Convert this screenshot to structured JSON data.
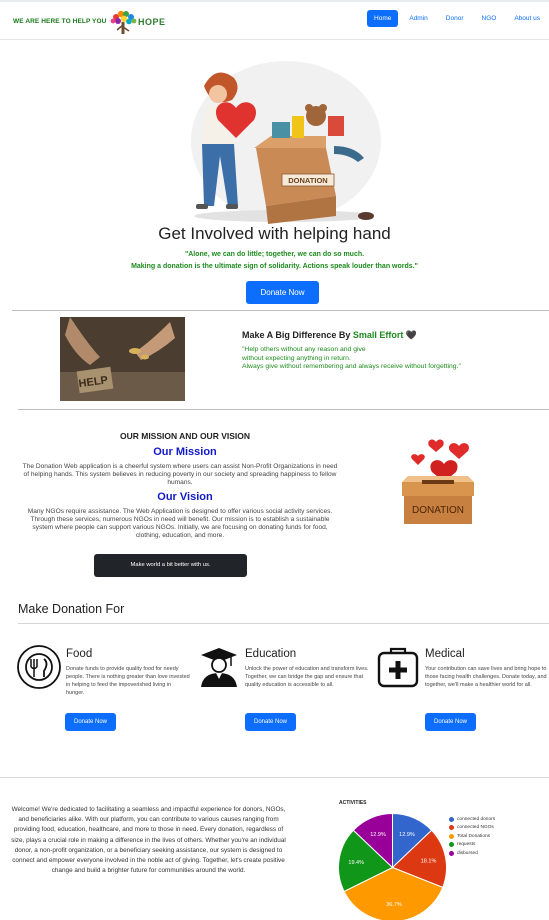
{
  "navbar": {
    "tagline": "WE ARE HERE TO HELP YOU",
    "brand": "HOPE",
    "links": [
      "Home",
      "Admin",
      "Donor",
      "NGO",
      "About us"
    ]
  },
  "hero": {
    "box_label": "DONATION",
    "title": "Get Involved with helping hand",
    "quote_line1": "\"Alone, we can do little; together, we can do so much.",
    "quote_line2": "Making a donation is the ultimate sign of solidarity. Actions speak louder than words.\"",
    "button": "Donate Now"
  },
  "difference": {
    "image_text": "HELP",
    "title_prefix": "Make A Big Difference By ",
    "title_highlight": "Small Effort",
    "title_icon": "🖤",
    "text_line1": "\"Help others without any reason and give",
    "text_line2": "without expecting anything in return.",
    "text_line3": "Always give without remembering and always receive without forgetting.\""
  },
  "mission": {
    "heading": "OUR MISSION AND OUR VISION",
    "mission_title": "Our Mission",
    "mission_text": "The Donation Web application is a cheerful system where users can assist Non-Profit Organizations in need of helping hands. This system believes in reducing poverty in our society and spreading happiness to fellow humans.",
    "vision_title": "Our Vision",
    "vision_text": "Many NGOs require assistance. The Web Application is designed to offer various social activity services. Through these services, numerous NGOs in need will benefit. Our mission is to establish a sustainable system where people can support various NGOs. Initially, we are focusing on donating funds for food, clothing, education, and more.",
    "button": "Make world a bit better with us.",
    "box_label": "DONATION"
  },
  "donation_for": {
    "title": "Make Donation For",
    "categories": [
      {
        "title": "Food",
        "text": "Donate funds to provide quality food for needy people. There is nothing greater than love invested in helping to feed the impoverished living in hunger.",
        "button": "Donate Now",
        "icon": "food-plate-icon"
      },
      {
        "title": "Education",
        "text": "Unlock the power of education and transform lives. Together, we can bridge the gap and ensure that quality education is accessible to all.",
        "button": "Donate Now",
        "icon": "graduate-icon"
      },
      {
        "title": "Medical",
        "text": "Your contribution can save lives and bring hope to those facing health challenges. Donate today, and together, we'll make a healthier world for all.",
        "button": "Donate Now",
        "icon": "medical-kit-icon"
      }
    ]
  },
  "welcome": {
    "text": "Welcome! We're dedicated to facilitating a seamless and impactful experience for donors, NGOs, and beneficiaries alike. With our platform, you can contribute to various causes ranging from providing food, education, healthcare, and more to those in need. Every donation, regardless of size, plays a crucial role in making a difference in the lives of others. Whether you're an individual donor, a non-profit organization, or a beneficiary seeking assistance, our system is designed to connect and empower everyone involved in the noble act of giving. Together, let's create positive change and build a brighter future for communities around the world."
  },
  "chart_data": {
    "type": "pie",
    "title": "ACTIVITIES",
    "legend_position": "right",
    "labels": [
      "connected donors",
      "connected NGOs",
      "Total Donations",
      "requests",
      "disbursed"
    ],
    "values": [
      12.9,
      18.1,
      36.7,
      19.4,
      12.9
    ],
    "value_labels": [
      "12.9%",
      "18.1%",
      "36.7%",
      "19.4%",
      "12.9%"
    ],
    "colors": [
      "#3366cc",
      "#dc3912",
      "#ff9900",
      "#109618",
      "#990099"
    ]
  },
  "colors": {
    "primary": "#0d6efd",
    "accent_green": "#1e8b1e",
    "mission_blue": "#1219c9",
    "dark": "#212529"
  }
}
